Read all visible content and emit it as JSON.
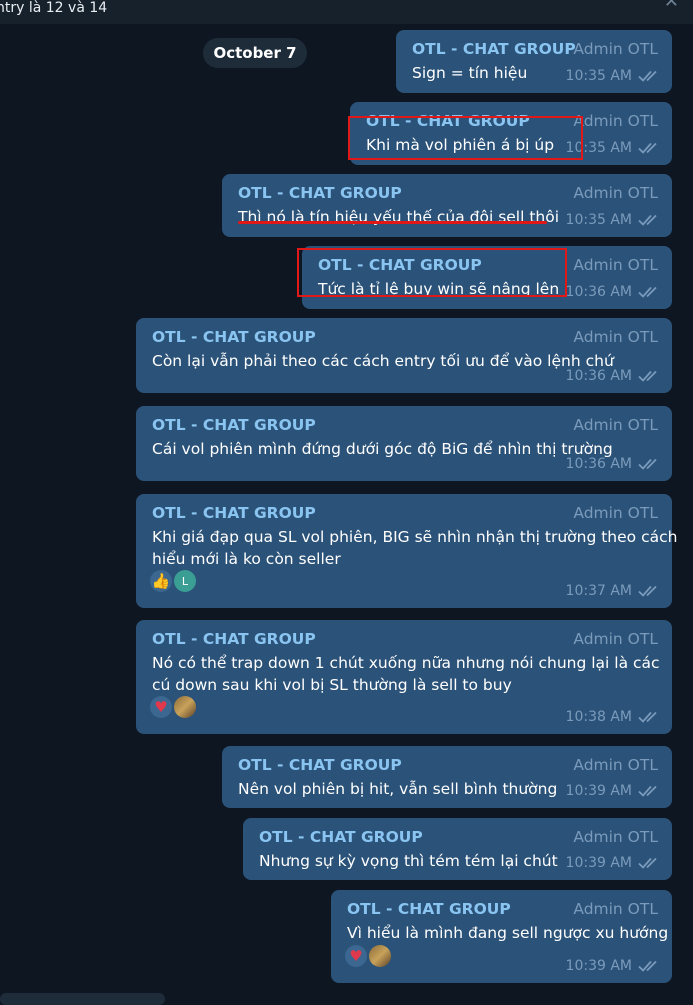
{
  "header": {
    "title": "ntry là 12 và 14",
    "close_icon": "close-icon"
  },
  "date_chip": "October 7",
  "colors": {
    "background": "#0e1621",
    "bubble": "#2b5278",
    "sender": "#8ac5f2",
    "meta": "#7a9bbb",
    "highlight": "#e01818"
  },
  "messages": [
    {
      "sender": "OTL - CHAT GROUP",
      "author": "Admin OTL",
      "lines": [
        "Sign = tín hiệu"
      ],
      "time": "10:35 AM"
    },
    {
      "sender": "OTL - CHAT GROUP",
      "author": "Admin OTL",
      "lines": [
        "Khi mà vol phiên á bị úp"
      ],
      "time": "10:35 AM",
      "highlighted": true
    },
    {
      "sender": "OTL - CHAT GROUP",
      "author": "Admin OTL",
      "lines": [
        "Thì nó là tín hiệu yếu thế của đôi sell thôi"
      ],
      "time": "10:35 AM",
      "underlined": true
    },
    {
      "sender": "OTL - CHAT GROUP",
      "author": "Admin OTL",
      "lines": [
        "Tức là tỉ lệ buy win sẽ nâng lên"
      ],
      "time": "10:36 AM",
      "highlighted": true
    },
    {
      "sender": "OTL - CHAT GROUP",
      "author": "Admin OTL",
      "lines": [
        "Còn lại vẫn phải theo các cách entry tối ưu để vào lệnh chứ"
      ],
      "time": "10:36 AM"
    },
    {
      "sender": "OTL - CHAT GROUP",
      "author": "Admin OTL",
      "lines": [
        "Cái vol phiên mình đứng dưới góc độ BiG để nhìn thị trường"
      ],
      "time": "10:36 AM"
    },
    {
      "sender": "OTL - CHAT GROUP",
      "author": "Admin OTL",
      "lines": [
        "Khi giá đạp qua SL vol phiên, BIG sẽ nhìn nhận thị trường theo cách",
        "hiểu mới là ko còn seller"
      ],
      "time": "10:37 AM",
      "reactions": [
        {
          "emoji": "👍",
          "icon": "thumbs-up-icon"
        },
        {
          "avatar_letter": "L"
        }
      ]
    },
    {
      "sender": "OTL - CHAT GROUP",
      "author": "Admin OTL",
      "lines": [
        "Nó có thể trap down 1 chút xuống nữa nhưng nói chung lại là các",
        "cú down sau khi vol bị SL thường là sell to buy"
      ],
      "time": "10:38 AM",
      "reactions": [
        {
          "emoji": "♥",
          "icon": "heart-icon"
        },
        {
          "avatar_photo": true
        }
      ]
    },
    {
      "sender": "OTL - CHAT GROUP",
      "author": "Admin OTL",
      "lines": [
        "Nên vol phiên bị hit, vẫn sell bình thường"
      ],
      "time": "10:39 AM"
    },
    {
      "sender": "OTL - CHAT GROUP",
      "author": "Admin OTL",
      "lines": [
        "Nhưng sự kỳ vọng thì tém tém lại chút"
      ],
      "time": "10:39 AM"
    },
    {
      "sender": "OTL - CHAT GROUP",
      "author": "Admin OTL",
      "lines": [
        "Vì hiểu là mình đang sell ngược xu hướng"
      ],
      "time": "10:39 AM",
      "reactions": [
        {
          "emoji": "♥",
          "icon": "heart-icon"
        },
        {
          "avatar_photo": true
        }
      ]
    }
  ]
}
